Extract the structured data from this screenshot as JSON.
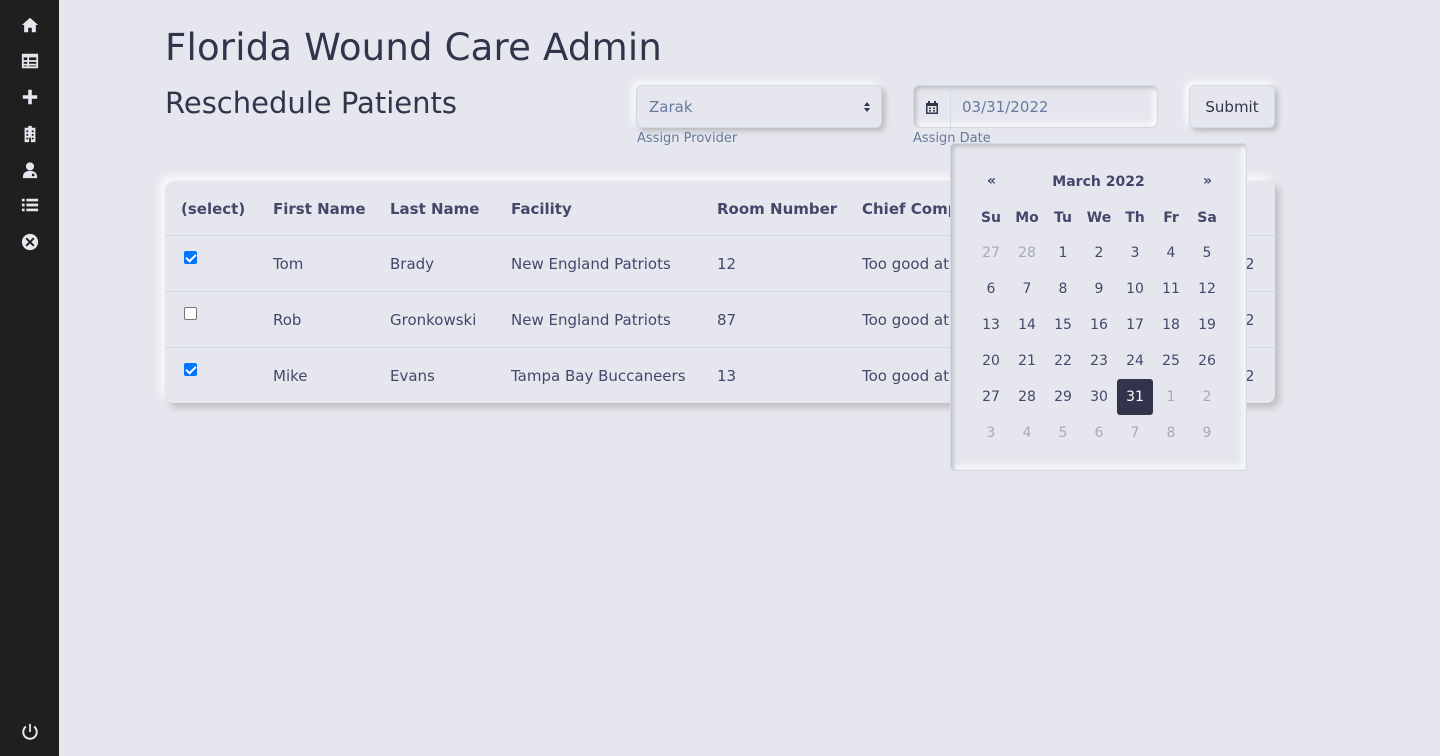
{
  "app_title": "Florida Wound Care Admin",
  "page_title": "Reschedule Patients",
  "sidebar": {
    "icons": [
      "home-icon",
      "table-icon",
      "plus-icon",
      "building-icon",
      "doctor-icon",
      "list-icon",
      "close-circle-icon",
      "power-icon"
    ]
  },
  "form": {
    "provider_value": "Zarak",
    "provider_label": "Assign Provider",
    "date_value": "03/31/2022",
    "date_label": "Assign Date",
    "submit_label": "Submit"
  },
  "table": {
    "headers": [
      "(select)",
      "First Name",
      "Last Name",
      "Facility",
      "Room Number",
      "Chief Compl"
    ],
    "rows": [
      {
        "checked": true,
        "first": "Tom",
        "last": "Brady",
        "facility": "New England Patriots",
        "room": "12",
        "complaint": "Too good at",
        "tail": "2"
      },
      {
        "checked": false,
        "first": "Rob",
        "last": "Gronkowski",
        "facility": "New England Patriots",
        "room": "87",
        "complaint": "Too good at",
        "tail": "2"
      },
      {
        "checked": true,
        "first": "Mike",
        "last": "Evans",
        "facility": "Tampa Bay Buccaneers",
        "room": "13",
        "complaint": "Too good at",
        "tail": "2"
      }
    ]
  },
  "datepicker": {
    "prev": "«",
    "next": "»",
    "title": "March 2022",
    "days_of_week": [
      "Su",
      "Mo",
      "Tu",
      "We",
      "Th",
      "Fr",
      "Sa"
    ],
    "weeks": [
      [
        [
          "27",
          "muted"
        ],
        [
          "28",
          "muted"
        ],
        [
          "1",
          ""
        ],
        [
          "2",
          ""
        ],
        [
          "3",
          ""
        ],
        [
          "4",
          ""
        ],
        [
          "5",
          ""
        ]
      ],
      [
        [
          "6",
          ""
        ],
        [
          "7",
          ""
        ],
        [
          "8",
          ""
        ],
        [
          "9",
          ""
        ],
        [
          "10",
          ""
        ],
        [
          "11",
          ""
        ],
        [
          "12",
          ""
        ]
      ],
      [
        [
          "13",
          ""
        ],
        [
          "14",
          ""
        ],
        [
          "15",
          ""
        ],
        [
          "16",
          ""
        ],
        [
          "17",
          ""
        ],
        [
          "18",
          ""
        ],
        [
          "19",
          ""
        ]
      ],
      [
        [
          "20",
          ""
        ],
        [
          "21",
          ""
        ],
        [
          "22",
          ""
        ],
        [
          "23",
          ""
        ],
        [
          "24",
          ""
        ],
        [
          "25",
          ""
        ],
        [
          "26",
          ""
        ]
      ],
      [
        [
          "27",
          ""
        ],
        [
          "28",
          ""
        ],
        [
          "29",
          ""
        ],
        [
          "30",
          ""
        ],
        [
          "31",
          "active"
        ],
        [
          "1",
          "muted"
        ],
        [
          "2",
          "muted"
        ]
      ],
      [
        [
          "3",
          "muted"
        ],
        [
          "4",
          "muted"
        ],
        [
          "5",
          "muted"
        ],
        [
          "6",
          "muted"
        ],
        [
          "7",
          "muted"
        ],
        [
          "8",
          "muted"
        ],
        [
          "9",
          "muted"
        ]
      ]
    ]
  },
  "colors": {
    "background": "#e6e7ee",
    "sidebar": "#1f1f1f",
    "text": "#31344b",
    "active_day": "#31344b",
    "checkbox": "#0075ff"
  }
}
